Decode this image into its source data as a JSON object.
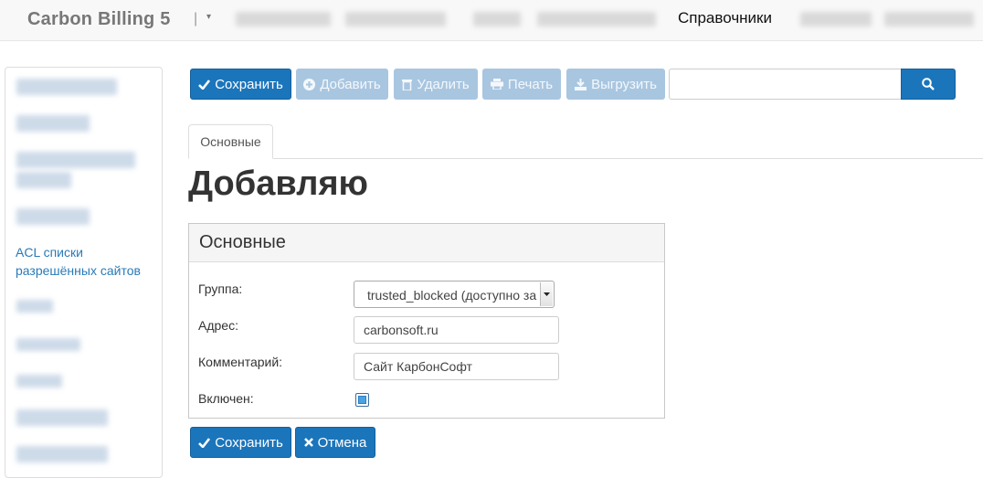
{
  "navbar": {
    "brand": "Carbon Billing 5",
    "separator": "|",
    "caret": "▾",
    "active_item": "Справочники"
  },
  "sidebar": {
    "link": "ACL списки разрешённых сайтов"
  },
  "toolbar": {
    "save_label": "Сохранить",
    "add_label": "Добавить",
    "delete_label": "Удалить",
    "print_label": "Печать",
    "export_label": "Выгрузить",
    "search_value": ""
  },
  "tabs": [
    {
      "label": "Основные"
    }
  ],
  "page_title": "Добавляю",
  "panel": {
    "title": "Основные",
    "group_label": "Группа:",
    "group_value": "trusted_blocked (доступно за",
    "address_label": "Адрес:",
    "address_value": "carbonsoft.ru",
    "comment_label": "Комментарий:",
    "comment_value": "Сайт КарбонСофт",
    "enabled_label": "Включен:",
    "enabled": true
  },
  "footer": {
    "save_label": "Сохранить",
    "cancel_label": "Отмена"
  },
  "colors": {
    "primary": "#1b75bb",
    "disabled": "#a9c6e0",
    "link": "#2a7ab8"
  }
}
